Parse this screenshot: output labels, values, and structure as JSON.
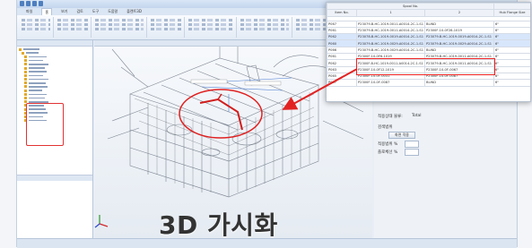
{
  "window": {
    "tabs": [
      "파일",
      "홈",
      "보기",
      "검토",
      "도구",
      "도움말",
      "플랜트3D"
    ],
    "active_tab_index": 1
  },
  "viewport": {
    "caption": "3D 가시화"
  },
  "props_panel": {
    "header_label": "적용상태 물류:",
    "header_value": "Total",
    "group_label": "검색범위",
    "apply_button": "화면 적용",
    "field1_label": "적용범위 %",
    "field2_label": "플로체선 %"
  },
  "spool_table": {
    "group_header": "Spool No.",
    "columns": [
      "Item No.",
      "1",
      "2",
      "Hub Flange Size"
    ],
    "rows": [
      {
        "item": "P067",
        "c1": "P23079-B-HC-1019-0011-A0014-2C-1-S1",
        "c2": "BLIND",
        "c3": "6\""
      },
      {
        "item": "P061",
        "c1": "P23079-B-HC-1019-0011-A0014-2C-1-S1",
        "c2": "P2300F-10-0F28-1019",
        "c3": "6\""
      },
      {
        "item": "P062",
        "c1": "P23078-B-HC-1019-0019-A0014-2C-1-S1",
        "c2": "P23079-B-HC-1019-0019-A0014-2C-1-S1",
        "c3": "6\""
      },
      {
        "item": "P060",
        "c1": "P23079-B-HC-1019-0029-A0014-2C-1-S1",
        "c2": "P23079-B-HC-1019-0029-A0014-2C-1-S1",
        "c3": "6\""
      },
      {
        "item": "P066",
        "c1": "P23079-B-HC-1019-0029-A0014-2C-1-S1",
        "c2": "BLIND",
        "c3": "6\""
      },
      {
        "item": "P061",
        "c1": "P2300F-10-0F6-1019",
        "c2": "P23079-B-HC-1019-0011-A0014-2C-1-S1",
        "c3": "6\""
      },
      {
        "item": "P062",
        "c1": "P2300F-B-HC-1019-0011-A0014-2C-1-S1",
        "c2": "P23079-B-HC-1019-0011-A0014-2C-1-S1",
        "c3": "6\""
      },
      {
        "item": "P063",
        "c1": "P2300F-10-0F12-1019",
        "c2": "P2300F-10-0F-0067",
        "c3": "6\""
      },
      {
        "item": "P065",
        "c1": "P2300F-10-0F-0031",
        "c2": "P2300F-10-0F-0087",
        "c3": "6\""
      },
      {
        "item": "P067",
        "c1": "P2300F-10-0F-0087",
        "c2": "BLIND",
        "c3": "6\""
      }
    ],
    "highlight_rows": [
      2,
      3
    ]
  },
  "colors": {
    "highlight_red": "#e22222",
    "ribbon_blue": "#4f7fbf",
    "selection_blue": "#d8e6fb"
  },
  "icons": [
    "quick-access-icon",
    "folder-icon",
    "axis-triad-icon"
  ]
}
